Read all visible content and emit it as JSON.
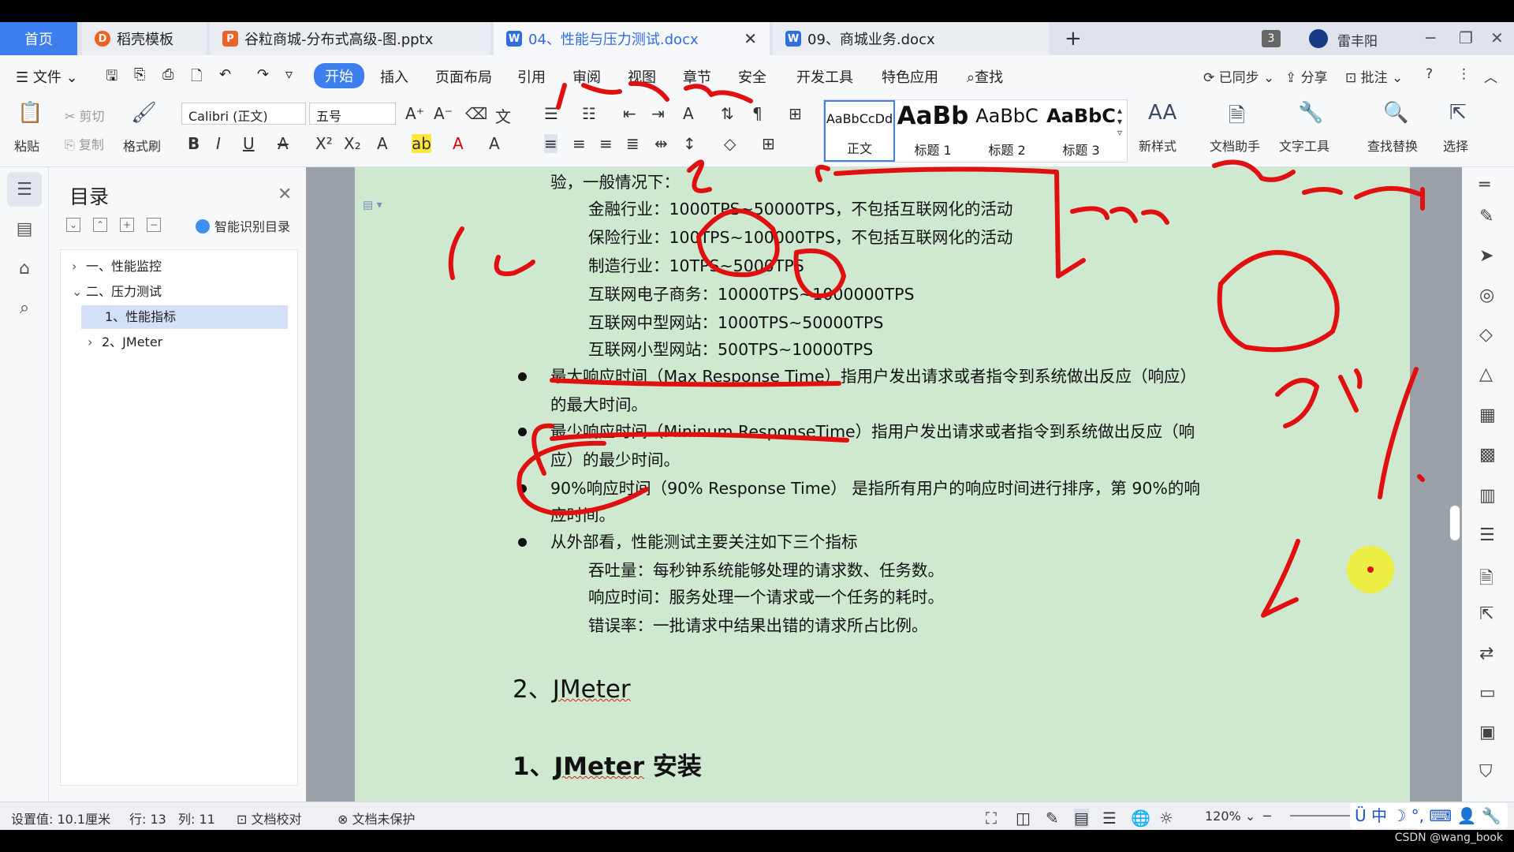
{
  "tabs": {
    "home": "首页",
    "t1": "稻壳模板",
    "t2": "谷粒商城-分布式高级-图.pptx",
    "t3": "04、性能与压力测试.docx",
    "t4": "09、商城业务.docx",
    "badge": "3",
    "user": "雷丰阳"
  },
  "menu": {
    "file": "文件",
    "items": [
      "开始",
      "插入",
      "页面布局",
      "引用",
      "审阅",
      "视图",
      "章节",
      "安全",
      "开发工具",
      "特色应用",
      "查找"
    ],
    "synced": "已同步",
    "share": "分享",
    "comment": "批注"
  },
  "ribbon": {
    "paste": "粘贴",
    "cut": "剪切",
    "copy": "复制",
    "format_painter": "格式刷",
    "font": "Calibri (正文)",
    "size": "五号",
    "styles": [
      {
        "preview": "AaBbCcDd",
        "label": "正文"
      },
      {
        "preview": "AaBb",
        "label": "标题 1"
      },
      {
        "preview": "AaBbC",
        "label": "标题 2"
      },
      {
        "preview": "AaBbC",
        "label": "标题 3"
      }
    ],
    "new_style": "新样式",
    "doc_helper": "文档助手",
    "text_tools": "文字工具",
    "find_replace": "查找替换",
    "select": "选择"
  },
  "toc": {
    "title": "目录",
    "ai_label": "智能识别目录",
    "items": [
      {
        "label": "一、性能监控",
        "expanded": false
      },
      {
        "label": "二、压力测试",
        "expanded": true
      },
      {
        "label": "1、性能指标",
        "selected": true
      },
      {
        "label": "2、JMeter",
        "expanded": false
      }
    ]
  },
  "doc": {
    "l0": "验，一般情况下：",
    "l1": "金融行业：1000TPS~50000TPS，不包括互联网化的活动",
    "l2": "保险行业：100TPS~100000TPS，不包括互联网化的活动",
    "l3": "制造行业：10TPS~5000TPS",
    "l4": "互联网电子商务：10000TPS~1000000TPS",
    "l5": "互联网中型网站：1000TPS~50000TPS",
    "l6": "互联网小型网站：500TPS~10000TPS",
    "b1a": "最大响应时间（Max Response Time）指用户发出请求或者指令到系统做出反应（响应）",
    "b1b": "的最大时间。",
    "b2a": "最少响应时间（Mininum ResponseTime）指用户发出请求或者指令到系统做出反应（响",
    "b2b": "应）的最少时间。",
    "b3a": "90%响应时间（90% Response Time） 是指所有用户的响应时间进行排序，第 90%的响",
    "b3b": "应时间。",
    "b4": "从外部看，性能测试主要关注如下三个指标",
    "m1": "吞吐量：每秒钟系统能够处理的请求数、任务数。",
    "m2": "响应时间：服务处理一个请求或一个任务的耗时。",
    "m3": "错误率：一批请求中结果出错的请求所占比例。",
    "h2_prefix": "2、",
    "h2_word": "JMeter",
    "h3_prefix": "1、",
    "h3_word": "JMeter",
    "h3_suffix": " 安装"
  },
  "status": {
    "setting": "设置值: 10.1厘米",
    "row": "行: 13",
    "col": "列: 11",
    "proof": "文档校对",
    "protect": "文档未保护",
    "zoom": "120%"
  },
  "ime": "中",
  "watermark": "CSDN @wang_book",
  "colors": {
    "accent": "#3e7ff0",
    "page_bg": "#cfe8d0",
    "ink": "#e01010"
  }
}
